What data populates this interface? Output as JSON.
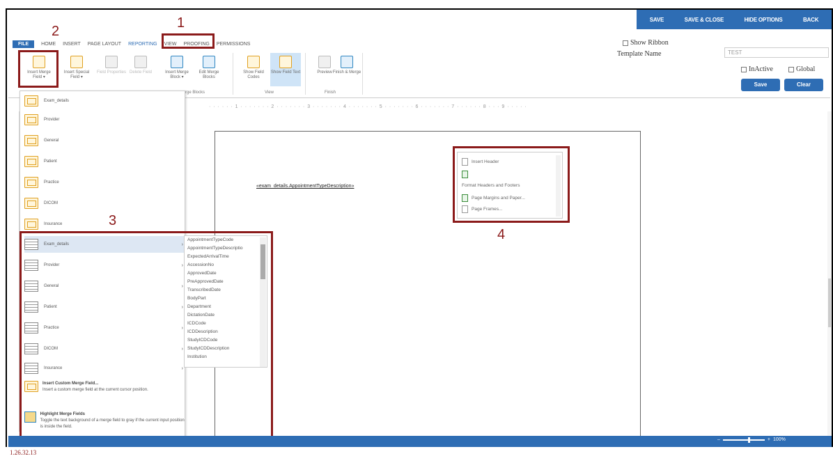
{
  "actionbar": {
    "save": "SAVE",
    "save_close": "SAVE & CLOSE",
    "hide_options": "HIDE OPTIONS",
    "back": "BACK"
  },
  "tabs": [
    "FILE",
    "HOME",
    "INSERT",
    "PAGE LAYOUT",
    "REPORTING",
    "VIEW",
    "PROOFING",
    "PERMISSIONS"
  ],
  "callouts": {
    "c1": "1",
    "c2": "2",
    "c3": "3",
    "c4": "4"
  },
  "ribbon": {
    "insert_merge_field": "Insert Merge Field ▾",
    "insert_special_field": "Insert Special Field ▾",
    "field_properties": "Field Properties",
    "delete_field": "Delete Field",
    "insert_merge_block": "Insert Merge Block ▾",
    "edit_merge_blocks": "Edit Merge Blocks",
    "show_field_codes": "Show Field Codes",
    "show_field_text": "Show Field Text",
    "preview": "Preview",
    "finish_merge": "Finish & Merge",
    "group_merge_blocks": "rge Blocks",
    "group_view": "View",
    "group_finish": "Finish"
  },
  "right_panel": {
    "show_ribbon": "Show Ribbon",
    "template_name_label": "Template Name",
    "template_name_value": "TEST",
    "inactive": "InActive",
    "global": "Global",
    "save": "Save",
    "clear": "Clear"
  },
  "ruler": "· · · · · · 1 · · · · · · · 2 · · · · · · · 3 · · · · · · · 4 · · · · · · · 5 · · · · · · · 6 · · · · · · · 7 · · · · · · 8 · · · 9 · · · · ·",
  "document": {
    "merge_field": "«exam_details.AppointmentTypeDescription»"
  },
  "dropdown_folders": [
    "Exam_details",
    "Provider",
    "General",
    "Patient",
    "Practice",
    "DICOM",
    "Insurance"
  ],
  "dropdown_tables": [
    "Exam_details",
    "Provider",
    "General",
    "Patient",
    "Practice",
    "DICOM",
    "Insurance"
  ],
  "submenu": [
    "AppointmentTypeCode",
    "AppointmentTypeDescriptio",
    "ExpectedArrivalTime",
    "AccessionNo",
    "ApprovedDate",
    "PreApprovedDate",
    "TranscribedDate",
    "BodyPart",
    "Department",
    "DictationDate",
    "ICDCode",
    "ICDDescription",
    "StudyICDCode",
    "StudyICDDescription",
    "Institution"
  ],
  "custom": {
    "insert_title": "Insert Custom Merge Field...",
    "insert_desc": "Insert a custom merge field at the current cursor position.",
    "highlight_title": "Highlight Merge Fields",
    "highlight_desc": "Toggle the text background of a merge field to gray if the current input position is inside the field."
  },
  "header_footer": {
    "insert_header": "Insert Header",
    "format": "Format Headers and Footers",
    "margins": "Page Margins and Paper...",
    "frames": "Page Frames..."
  },
  "status": {
    "zoom": "100%"
  },
  "version": "1.26.32.13",
  "colors": {
    "accent": "#2e6db4",
    "callout": "#8b1a1a"
  }
}
